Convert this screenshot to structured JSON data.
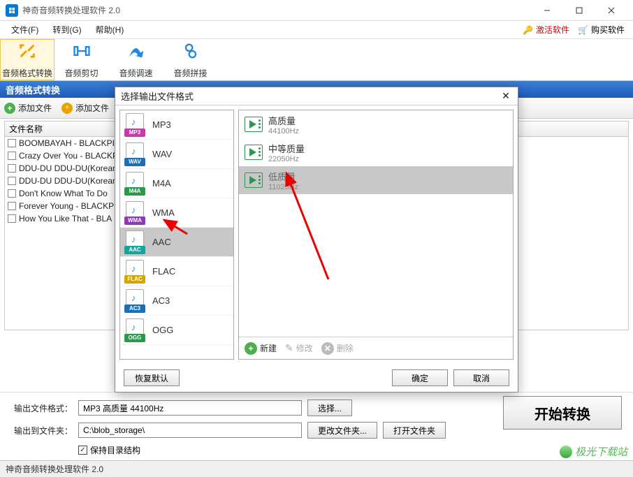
{
  "window": {
    "title": "神奇音频转换处理软件 2.0"
  },
  "menu": {
    "file": "文件(F)",
    "goto": "转到(G)",
    "help": "帮助(H)",
    "activate": "激活软件",
    "buy": "购买软件"
  },
  "toolbar": {
    "convert": "音频格式转换",
    "cut": "音频剪切",
    "speed": "音频调速",
    "join": "音频拼接"
  },
  "section": {
    "title": "音频格式转换"
  },
  "addbar": {
    "addFile": "添加文件",
    "addFolder": "添加文件"
  },
  "filelist": {
    "header": "文件名称",
    "rows": [
      "BOOMBAYAH - BLACKPIN",
      "Crazy Over You - BLACKP",
      "DDU-DU DDU-DU(Korean",
      "DDU-DU DDU-DU(Korean",
      "Don't Know What To Do",
      "Forever Young - BLACKPI",
      "How You Like That - BLA"
    ]
  },
  "bottom": {
    "outFormatLabel": "输出文件格式：",
    "outFormatValue": "MP3 高质量 44100Hz",
    "selectBtn": "选择...",
    "outFolderLabel": "输出到文件夹：",
    "outFolderValue": "C:\\blob_storage\\",
    "changeFolder": "更改文件夹...",
    "openFolder": "打开文件夹",
    "keepDir": "保持目录结构",
    "start": "开始转换"
  },
  "status": {
    "text": "神奇音频转换处理软件 2.0",
    "brand": "极光下载站"
  },
  "dialog": {
    "title": "选择输出文件格式",
    "formats": [
      {
        "label": "MP3",
        "band": "#c73aa5"
      },
      {
        "label": "WAV",
        "band": "#1a6fb5"
      },
      {
        "label": "M4A",
        "band": "#2a9a4a"
      },
      {
        "label": "WMA",
        "band": "#8a3ab5"
      },
      {
        "label": "AAC",
        "band": "#12a59a"
      },
      {
        "label": "FLAC",
        "band": "#d8a500"
      },
      {
        "label": "AC3",
        "band": "#1a6fb5"
      },
      {
        "label": "OGG",
        "band": "#2a9a4a"
      }
    ],
    "selectedFormatIndex": 4,
    "qualities": [
      {
        "t1": "高质量",
        "t2": "44100Hz"
      },
      {
        "t1": "中等质量",
        "t2": "22050Hz"
      },
      {
        "t1": "低质量",
        "t2": "11025Hz"
      }
    ],
    "selectedQualityIndex": 2,
    "toolbar": {
      "new": "新建",
      "edit": "修改",
      "del": "删除"
    },
    "footer": {
      "restore": "恢复默认",
      "ok": "确定",
      "cancel": "取消"
    }
  }
}
